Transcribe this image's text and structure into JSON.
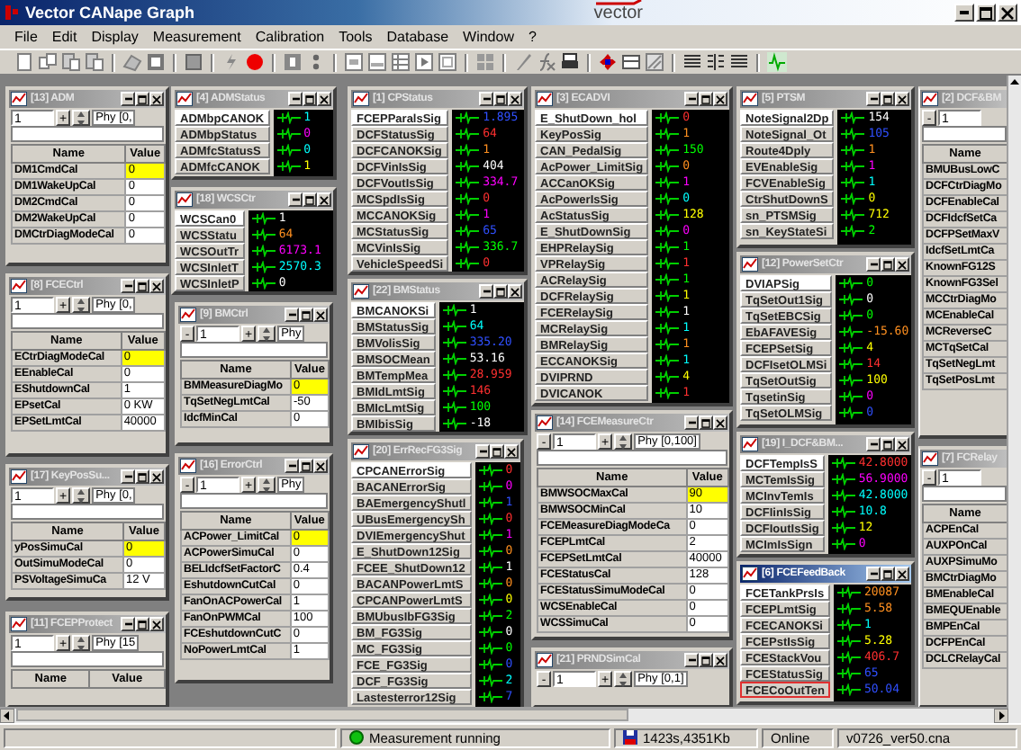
{
  "window": {
    "title": "Vector CANape Graph",
    "logo": "vector"
  },
  "menu": [
    "File",
    "Edit",
    "Display",
    "Measurement",
    "Calibration",
    "Tools",
    "Database",
    "Window",
    "?"
  ],
  "mdi_windows": [
    {
      "kind": "calibration",
      "title": "[13] ADM",
      "active": false,
      "toolbar": {
        "value": "1",
        "plus": "+",
        "range": "Phy [0,"
      },
      "columns": [
        "Name",
        "Value"
      ],
      "rows": [
        {
          "name": "DM1CmdCal",
          "value": "0",
          "selected": true
        },
        {
          "name": "DM1WakeUpCal",
          "value": "0",
          "selected": false
        },
        {
          "name": "DM2CmdCal",
          "value": "0",
          "selected": false
        },
        {
          "name": "DM2WakeUpCal",
          "value": "0",
          "selected": false
        },
        {
          "name": "DMCtrDiagModeCal",
          "value": "0",
          "selected": false
        }
      ]
    },
    {
      "kind": "calibration",
      "title": "[8] FCECtrl",
      "active": false,
      "toolbar": {
        "value": "1",
        "plus": "+",
        "range": "Phy [0,"
      },
      "columns": [
        "Name",
        "Value"
      ],
      "rows": [
        {
          "name": "ECtrDiagModeCal",
          "value": "0",
          "selected": true
        },
        {
          "name": "EEnableCal",
          "value": "0",
          "selected": false
        },
        {
          "name": "EShutdownCal",
          "value": "1",
          "selected": false
        },
        {
          "name": "EPsetCal",
          "value": "0 KW",
          "selected": false
        },
        {
          "name": "EPSetLmtCal",
          "value": "40000",
          "selected": false
        }
      ]
    },
    {
      "kind": "calibration",
      "title": "[17] KeyPosSu...",
      "active": false,
      "toolbar": {
        "value": "1",
        "plus": "+",
        "range": "Phy [0,"
      },
      "columns": [
        "Name",
        "Value"
      ],
      "rows": [
        {
          "name": "yPosSimuCal",
          "value": "0",
          "selected": true
        },
        {
          "name": "OutSimuModeCal",
          "value": "0",
          "selected": false
        },
        {
          "name": "PSVoltageSimuCa",
          "value": "12 V",
          "selected": false
        }
      ]
    },
    {
      "kind": "calibration",
      "title": "[11] FCEPProtect",
      "active": false,
      "toolbar": {
        "value": "1",
        "plus": "+",
        "range": "Phy [15"
      },
      "columns": [
        "Name",
        "Value"
      ]
    },
    {
      "kind": "measurement",
      "title": "[4] ADMStatus",
      "active": false,
      "rows": [
        {
          "name": "ADMbpCANOK",
          "value": "1",
          "color": "#00ffff"
        },
        {
          "name": "ADMbpStatus",
          "value": "0",
          "color": "#ff00ff"
        },
        {
          "name": "ADMfcStatusS",
          "value": "0",
          "color": "#00ffff"
        },
        {
          "name": "ADMfcCANOK",
          "value": "1",
          "color": "#ffff00"
        }
      ]
    },
    {
      "kind": "measurement",
      "title": "[18] WCSCtr",
      "active": false,
      "rows": [
        {
          "name": "WCSCan0",
          "value": "1",
          "color": "#ffffff"
        },
        {
          "name": "WCSStatu",
          "value": "64",
          "color": "#ff9020"
        },
        {
          "name": "WCSOutTr",
          "value": "6173.1",
          "color": "#ff00ff"
        },
        {
          "name": "WCSInletT",
          "value": "2570.3",
          "color": "#00ffff"
        },
        {
          "name": "WCSInletP",
          "value": "0",
          "color": "#ffffff"
        }
      ]
    },
    {
      "kind": "calibration",
      "title": "[9] BMCtrl",
      "active": false,
      "toolbar": {
        "minus": "-",
        "value": "1",
        "plus": "+",
        "range": "Phy"
      },
      "columns": [
        "Name",
        "Value"
      ],
      "rows": [
        {
          "name": "BMMeasureDiagMo",
          "value": "0",
          "selected": true
        },
        {
          "name": "TqSetNegLmtCal",
          "value": "-50",
          "selected": false
        },
        {
          "name": "IdcfMinCal",
          "value": "0",
          "selected": false
        }
      ]
    },
    {
      "kind": "calibration",
      "title": "[16] ErrorCtrl",
      "active": false,
      "toolbar": {
        "minus": "-",
        "value": "1",
        "plus": "+",
        "range": "Phy"
      },
      "columns": [
        "Name",
        "Value"
      ],
      "rows": [
        {
          "name": "ACPower_LimitCal",
          "value": "0",
          "selected": true
        },
        {
          "name": "ACPowerSimuCal",
          "value": "0",
          "selected": false
        },
        {
          "name": "BELIdcfSetFactorC",
          "value": "0.4",
          "selected": false
        },
        {
          "name": "EshutdownCutCal",
          "value": "0",
          "selected": false
        },
        {
          "name": "FanOnACPowerCal",
          "value": "1",
          "selected": false
        },
        {
          "name": "FanOnPWMCal",
          "value": "100",
          "selected": false
        },
        {
          "name": "FCEshutdownCutC",
          "value": "0",
          "selected": false
        },
        {
          "name": "NoPowerLmtCal",
          "value": "1",
          "selected": false
        }
      ]
    },
    {
      "kind": "measurement",
      "title": "[1] CPStatus",
      "active": false,
      "rows": [
        {
          "name": "FCEPParalsSig",
          "value": "1.895",
          "color": "#3050ff"
        },
        {
          "name": "DCFStatusSig",
          "value": "64",
          "color": "#ff3030"
        },
        {
          "name": "DCFCANOKSig",
          "value": "1",
          "color": "#ff9020"
        },
        {
          "name": "DCFVinIsSig",
          "value": "404",
          "color": "#ffffff"
        },
        {
          "name": "DCFVoutIsSig",
          "value": "334.7",
          "color": "#ff00ff"
        },
        {
          "name": "MCSpdIsSig",
          "value": "0",
          "color": "#ff3030"
        },
        {
          "name": "MCCANOKSig",
          "value": "1",
          "color": "#ff00ff"
        },
        {
          "name": "MCStatusSig",
          "value": "65",
          "color": "#3050ff"
        },
        {
          "name": "MCVinIsSig",
          "value": "336.7",
          "color": "#00ff00"
        },
        {
          "name": "VehicleSpeedSi",
          "value": "0",
          "color": "#ff3030"
        }
      ]
    },
    {
      "kind": "measurement",
      "title": "[22] BMStatus",
      "active": false,
      "rows": [
        {
          "name": "BMCANOKSi",
          "value": "1",
          "color": "#ffffff"
        },
        {
          "name": "BMStatusSig",
          "value": "64",
          "color": "#00ffff"
        },
        {
          "name": "BMVolisSig",
          "value": "335.20",
          "color": "#3050ff"
        },
        {
          "name": "BMSOCMean",
          "value": "53.16",
          "color": "#ffffff"
        },
        {
          "name": "BMTempMea",
          "value": "28.959",
          "color": "#ff3030"
        },
        {
          "name": "BMIdLmtSig",
          "value": "146",
          "color": "#ff3030"
        },
        {
          "name": "BMIcLmtSig",
          "value": "100",
          "color": "#00ff00"
        },
        {
          "name": "BMIbisSig",
          "value": "-18",
          "color": "#ffffff"
        }
      ]
    },
    {
      "kind": "measurement",
      "title": "[20] ErrRecFG3Sig",
      "active": false,
      "rows": [
        {
          "name": "CPCANErrorSig",
          "value": "0",
          "color": "#ff3030"
        },
        {
          "name": "BACANErrorSig",
          "value": "0",
          "color": "#ff00ff"
        },
        {
          "name": "BAEmergencyShutl",
          "value": "1",
          "color": "#3050ff"
        },
        {
          "name": "UBusEmergencySh",
          "value": "0",
          "color": "#ff3030"
        },
        {
          "name": "DVIEmergencyShut",
          "value": "1",
          "color": "#ff00ff"
        },
        {
          "name": "E_ShutDown12Sig",
          "value": "0",
          "color": "#ff9020"
        },
        {
          "name": "FCEE_ShutDown12",
          "value": "1",
          "color": "#ffffff"
        },
        {
          "name": "BACANPowerLmtS",
          "value": "0",
          "color": "#ff9020"
        },
        {
          "name": "CPCANPowerLmtS",
          "value": "0",
          "color": "#ffff00"
        },
        {
          "name": "BMUbusIbFG3Sig",
          "value": "2",
          "color": "#00ff00"
        },
        {
          "name": "BM_FG3Sig",
          "value": "0",
          "color": "#ffffff"
        },
        {
          "name": "MC_FG3Sig",
          "value": "0",
          "color": "#00ff00"
        },
        {
          "name": "FCE_FG3Sig",
          "value": "0",
          "color": "#3050ff"
        },
        {
          "name": "DCF_FG3Sig",
          "value": "2",
          "color": "#00ffff"
        },
        {
          "name": "Lastesterror12Sig",
          "value": "7",
          "color": "#3050ff"
        }
      ]
    },
    {
      "kind": "measurement",
      "title": "[3] ECADVI",
      "active": false,
      "rows": [
        {
          "name": "E_ShutDown_hol",
          "value": "0",
          "color": "#ff3030"
        },
        {
          "name": "KeyPosSig",
          "value": "1",
          "color": "#ff9020"
        },
        {
          "name": "CAN_PedalSig",
          "value": "150",
          "color": "#00ff00"
        },
        {
          "name": "AcPower_LimitSig",
          "value": "0",
          "color": "#ff9020"
        },
        {
          "name": "ACCanOKSig",
          "value": "1",
          "color": "#ff00ff"
        },
        {
          "name": "AcPowerIsSig",
          "value": "0",
          "color": "#00ffff"
        },
        {
          "name": "AcStatusSig",
          "value": "128",
          "color": "#ffff00"
        },
        {
          "name": "E_ShutDownSig",
          "value": "0",
          "color": "#ff00ff"
        },
        {
          "name": "EHPRelaySig",
          "value": "1",
          "color": "#00ff00"
        },
        {
          "name": "VPRelaySig",
          "value": "1",
          "color": "#ff3030"
        },
        {
          "name": "ACRelaySig",
          "value": "1",
          "color": "#00ff00"
        },
        {
          "name": "DCFRelaySig",
          "value": "1",
          "color": "#ffff00"
        },
        {
          "name": "FCERelaySig",
          "value": "1",
          "color": "#ffffff"
        },
        {
          "name": "MCRelaySig",
          "value": "1",
          "color": "#00ffff"
        },
        {
          "name": "BMRelaySig",
          "value": "1",
          "color": "#ff9020"
        },
        {
          "name": "ECCANOKSig",
          "value": "1",
          "color": "#00ffff"
        },
        {
          "name": "DVIPRND",
          "value": "4",
          "color": "#ffff00"
        },
        {
          "name": "DVICANOK",
          "value": "1",
          "color": "#ff3030"
        }
      ]
    },
    {
      "kind": "calibration",
      "title": "[14] FCEMeasureCtr",
      "active": false,
      "toolbar": {
        "minus": "-",
        "value": "1",
        "plus": "+",
        "range": "Phy [0,100]"
      },
      "columns": [
        "Name",
        "Value"
      ],
      "rows": [
        {
          "name": "BMWSOCMaxCal",
          "value": "90",
          "selected": true
        },
        {
          "name": "BMWSOCMinCal",
          "value": "10",
          "selected": false
        },
        {
          "name": "FCEMeasureDiagModeCa",
          "value": "0",
          "selected": false
        },
        {
          "name": "FCEPLmtCal",
          "value": "2",
          "selected": false
        },
        {
          "name": "FCEPSetLmtCal",
          "value": "40000",
          "selected": false
        },
        {
          "name": "FCEStatusCal",
          "value": "128",
          "selected": false
        },
        {
          "name": "FCEStatusSimuModeCal",
          "value": "0",
          "selected": false
        },
        {
          "name": "WCSEnableCal",
          "value": "0",
          "selected": false
        },
        {
          "name": "WCSSimuCal",
          "value": "0",
          "selected": false
        }
      ]
    },
    {
      "kind": "calibration",
      "title": "[21] PRNDSimCal",
      "active": false,
      "toolbar": {
        "minus": "-",
        "value": "1",
        "plus": "+",
        "range": "Phy [0,1]"
      }
    },
    {
      "kind": "measurement",
      "title": "[5] PTSM",
      "active": false,
      "rows": [
        {
          "name": "NoteSignal2Dp",
          "value": "154",
          "color": "#ffffff"
        },
        {
          "name": "NoteSignal_Ot",
          "value": "105",
          "color": "#3050ff"
        },
        {
          "name": "Route4Dply",
          "value": "1",
          "color": "#ff9020"
        },
        {
          "name": "EVEnableSig",
          "value": "1",
          "color": "#ff00ff"
        },
        {
          "name": "FCVEnableSig",
          "value": "1",
          "color": "#00ffff"
        },
        {
          "name": "CtrShutDownS",
          "value": "0",
          "color": "#ffff00"
        },
        {
          "name": "sn_PTSMSig",
          "value": "712",
          "color": "#ffff00"
        },
        {
          "name": "sn_KeyStateSi",
          "value": "2",
          "color": "#00ff00"
        }
      ]
    },
    {
      "kind": "measurement",
      "title": "[12] PowerSetCtr",
      "active": false,
      "rows": [
        {
          "name": "DVIAPSig",
          "value": "0",
          "color": "#00ff00"
        },
        {
          "name": "TqSetOut1Sig",
          "value": "0",
          "color": "#ffffff"
        },
        {
          "name": "TqSetEBCSig",
          "value": "0",
          "color": "#00ff00"
        },
        {
          "name": "EbAFAVESig",
          "value": "-15.60",
          "color": "#ff9020"
        },
        {
          "name": "FCEPSetSig",
          "value": "4",
          "color": "#ffff00"
        },
        {
          "name": "DCFIsetOLMSi",
          "value": "14",
          "color": "#ff3030"
        },
        {
          "name": "TqSetOutSig",
          "value": "100",
          "color": "#ffff00"
        },
        {
          "name": "TqsetinSig",
          "value": "0",
          "color": "#ff00ff"
        },
        {
          "name": "TqSetOLMSig",
          "value": "0",
          "color": "#3050ff"
        }
      ]
    },
    {
      "kind": "measurement",
      "title": "[19] I_DCF&BM...",
      "active": false,
      "rows": [
        {
          "name": "DCFTempIsS",
          "value": "42.8000",
          "color": "#ff3030"
        },
        {
          "name": "MCTemIsSig",
          "value": "56.9000",
          "color": "#ff00ff"
        },
        {
          "name": "MCInvTemIs",
          "value": "42.8000",
          "color": "#00ffff"
        },
        {
          "name": "DCFIinIsSig",
          "value": "10.8",
          "color": "#00ffff"
        },
        {
          "name": "DCFIoutIsSig",
          "value": "12",
          "color": "#ffff00"
        },
        {
          "name": "MCImIsSign",
          "value": "0",
          "color": "#ff00ff"
        }
      ]
    },
    {
      "kind": "measurement",
      "title": "[6] FCEFeedBack",
      "active": true,
      "rows": [
        {
          "name": "FCETankPrsIs",
          "value": "20087",
          "color": "#ff9020",
          "selected": false
        },
        {
          "name": "FCEPLmtSig",
          "value": "5.58",
          "color": "#ff9020",
          "selected": false
        },
        {
          "name": "FCECANOKSi",
          "value": "1",
          "color": "#00ffff",
          "selected": false
        },
        {
          "name": "FCEPstIsSig",
          "value": "5.28",
          "color": "#ffff00",
          "selected": false
        },
        {
          "name": "FCEStackVou",
          "value": "406.7",
          "color": "#ff3030",
          "selected": false
        },
        {
          "name": "FCEStatusSig",
          "value": "65",
          "color": "#3050ff",
          "selected": false
        },
        {
          "name": "FCECoOutTen",
          "value": "50.04",
          "color": "#3050ff",
          "selected": true
        }
      ]
    },
    {
      "kind": "calibration",
      "title": "[2] DCF&BM",
      "active": false,
      "toolbar": {
        "minus": "-",
        "value": "1"
      },
      "columns": [
        "Name"
      ],
      "rows": [
        {
          "name": "BMUBusLowC"
        },
        {
          "name": "DCFCtrDiagMo"
        },
        {
          "name": "DCFEnableCal"
        },
        {
          "name": "DCFIdcfSetCa"
        },
        {
          "name": "DCFPSetMaxV"
        },
        {
          "name": "IdcfSetLmtCa"
        },
        {
          "name": "KnownFG12S"
        },
        {
          "name": "KnownFG3Sel"
        },
        {
          "name": "MCCtrDiagMo"
        },
        {
          "name": "MCEnableCal"
        },
        {
          "name": "MCReverseC"
        },
        {
          "name": "MCTqSetCal"
        },
        {
          "name": "TqSetNegLmt"
        },
        {
          "name": "TqSetPosLmt"
        }
      ]
    },
    {
      "kind": "calibration",
      "title": "[7] FCRelay",
      "active": false,
      "toolbar": {
        "minus": "-",
        "value": "1"
      },
      "columns": [
        "Name"
      ],
      "rows": [
        {
          "name": "ACPEnCal"
        },
        {
          "name": "AUXPOnCal"
        },
        {
          "name": "AUXPSimuMo"
        },
        {
          "name": "BMCtrDiagMo"
        },
        {
          "name": "BMEnableCal"
        },
        {
          "name": "BMEQUEnable"
        },
        {
          "name": "BMPEnCal"
        },
        {
          "name": "DCFPEnCal"
        },
        {
          "name": "DCLCRelayCal"
        }
      ]
    }
  ],
  "status_bar": {
    "measurement": "Measurement running",
    "running": true,
    "memory": "1423s,4351Kb",
    "connection": "Online",
    "file": "v0726_ver50.cna"
  }
}
